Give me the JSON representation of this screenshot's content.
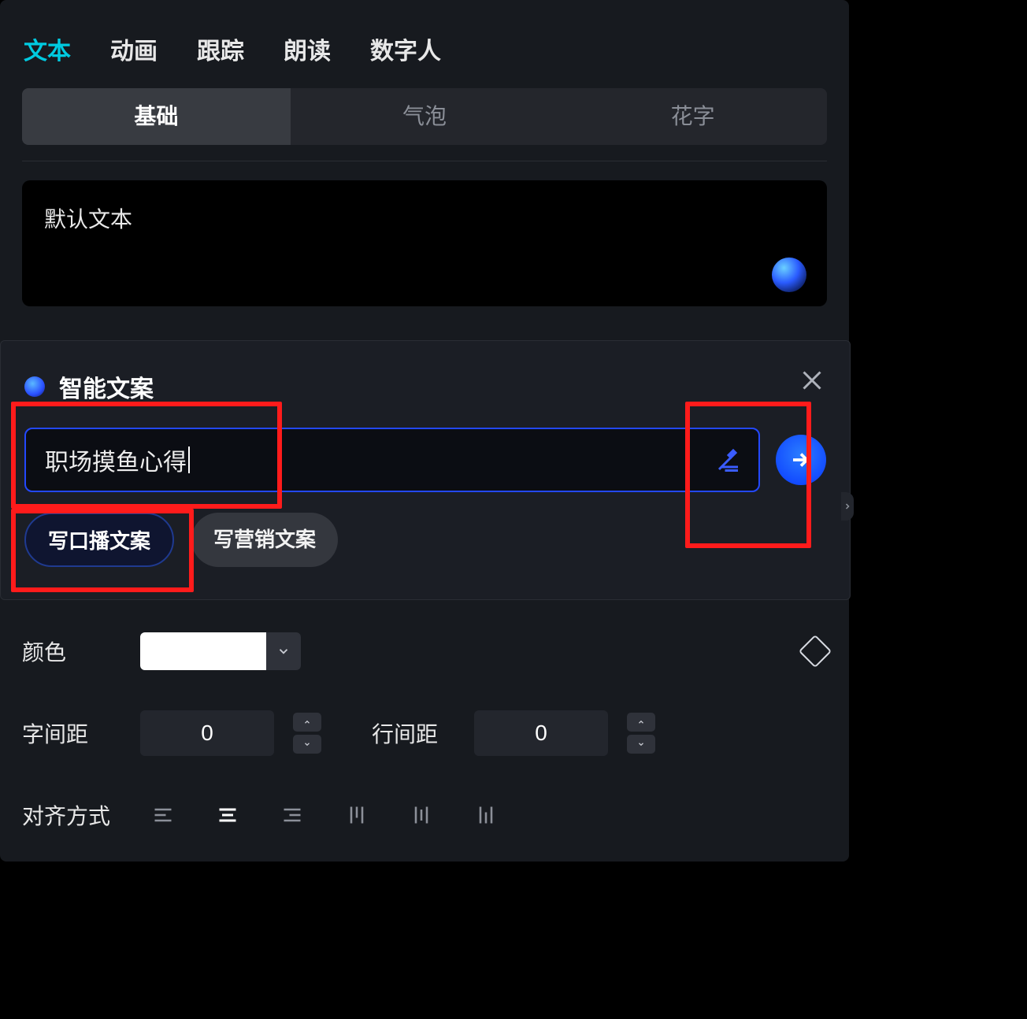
{
  "top_tabs": {
    "text": "文本",
    "animation": "动画",
    "tracking": "跟踪",
    "tts": "朗读",
    "digital_human": "数字人"
  },
  "sub_tabs": {
    "basic": "基础",
    "bubble": "气泡",
    "fancy": "花字"
  },
  "text_box": {
    "value": "默认文本"
  },
  "ai": {
    "title": "智能文案",
    "input_value": "职场摸鱼心得",
    "chip_script": "写口播文案",
    "chip_marketing": "写营销文案"
  },
  "color": {
    "label": "颜色",
    "value": "#FFFFFF"
  },
  "letter_spacing": {
    "label": "字间距",
    "value": "0"
  },
  "line_spacing": {
    "label": "行间距",
    "value": "0"
  },
  "align": {
    "label": "对齐方式"
  }
}
